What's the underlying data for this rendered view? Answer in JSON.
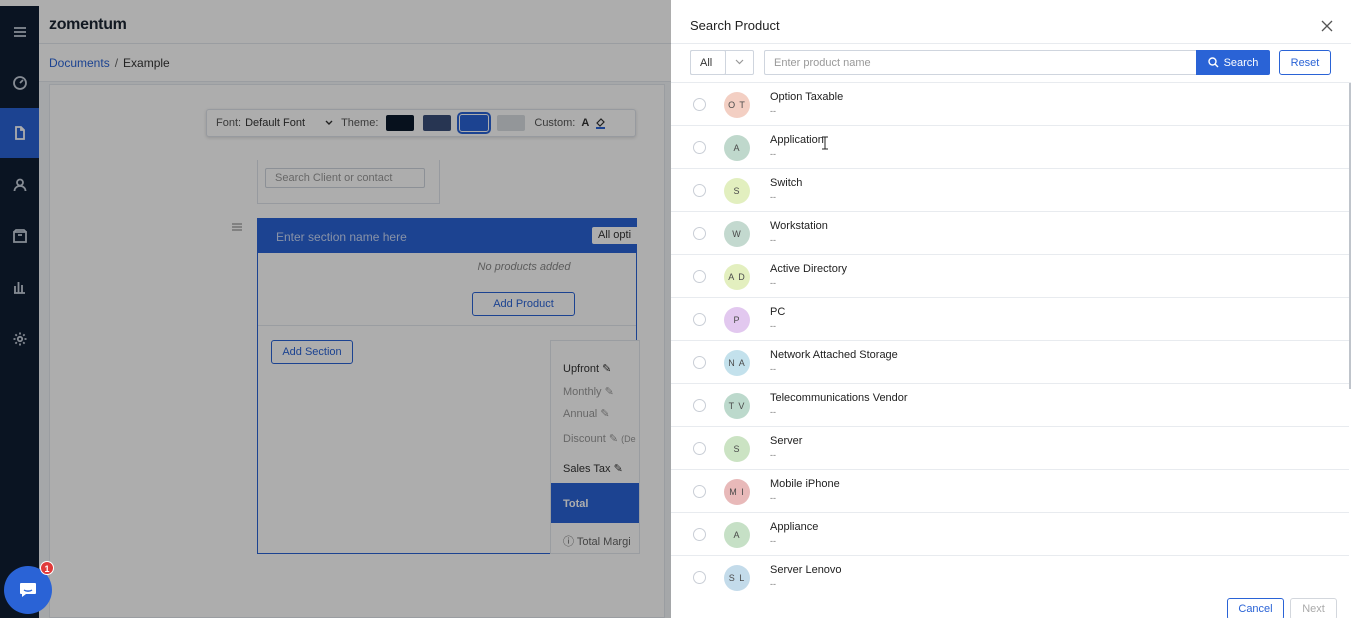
{
  "app": {
    "logo": "zomentum",
    "breadcrumb": {
      "parent": "Documents",
      "separator": "/",
      "current": "Example"
    }
  },
  "nav": {
    "items": [
      {
        "icon": "menu-icon"
      },
      {
        "icon": "dashboard-gauge-icon"
      },
      {
        "icon": "document-icon",
        "active": true
      },
      {
        "icon": "user-icon"
      },
      {
        "icon": "box-icon"
      },
      {
        "icon": "bar-chart-icon"
      },
      {
        "icon": "gear-icon"
      }
    ]
  },
  "editor": {
    "toolbar": {
      "font_label": "Font:",
      "font_value": "Default Font",
      "theme_label": "Theme:",
      "custom_label": "Custom:",
      "custom_a": "A",
      "theme_colors": [
        "#0b1a2c",
        "#3a4f7a",
        "#2a63d6",
        "#d9dde2"
      ]
    },
    "client_placeholder": "Search Client or contact",
    "section": {
      "name_placeholder": "Enter section name here",
      "all_options": "All opti",
      "no_products": "No products added",
      "add_product": "Add Product",
      "add_section": "Add Section"
    },
    "summary": {
      "upfront": "Upfront",
      "monthly": "Monthly",
      "annual": "Annual",
      "discount": "Discount",
      "discount_suffix": "(De",
      "sales_tax": "Sales Tax",
      "total": "Total",
      "total_margin": "Total Margi"
    }
  },
  "chat": {
    "badge": "1"
  },
  "drawer": {
    "title": "Search Product",
    "filter_value": "All",
    "search_placeholder": "Enter product name",
    "search_label": "Search",
    "reset_label": "Reset",
    "cancel_label": "Cancel",
    "next_label": "Next",
    "products": [
      {
        "initials": "O T",
        "name": "Option Taxable",
        "desc": "--",
        "color": "#f3cfc3"
      },
      {
        "initials": "A",
        "name": "Application",
        "desc": "--",
        "color": "#bfd8cc"
      },
      {
        "initials": "S",
        "name": "Switch",
        "desc": "--",
        "color": "#e2efbf"
      },
      {
        "initials": "W",
        "name": "Workstation",
        "desc": "--",
        "color": "#c3d9cf"
      },
      {
        "initials": "A D",
        "name": "Active Directory",
        "desc": "--",
        "color": "#e3efbf"
      },
      {
        "initials": "P",
        "name": "PC",
        "desc": "--",
        "color": "#e2c8ef"
      },
      {
        "initials": "N A",
        "name": "Network Attached Storage",
        "desc": "--",
        "color": "#c3e1ec"
      },
      {
        "initials": "T V",
        "name": "Telecommunications Vendor",
        "desc": "--",
        "color": "#bcd9cc"
      },
      {
        "initials": "S",
        "name": "Server",
        "desc": "--",
        "color": "#cbe3c3"
      },
      {
        "initials": "M I",
        "name": "Mobile iPhone",
        "desc": "--",
        "color": "#e8b9b9"
      },
      {
        "initials": "A",
        "name": "Appliance",
        "desc": "--",
        "color": "#c6e0c6"
      },
      {
        "initials": "S L",
        "name": "Server Lenovo",
        "desc": "--",
        "color": "#c3dbea"
      }
    ]
  }
}
